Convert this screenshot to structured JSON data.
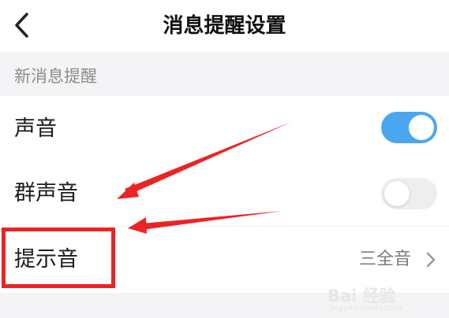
{
  "header": {
    "title": "消息提醒设置",
    "back_icon": "chevron-left-icon"
  },
  "section": {
    "label": "新消息提醒"
  },
  "rows": [
    {
      "label": "声音",
      "toggle_on": true
    },
    {
      "label": "群声音",
      "toggle_on": false
    },
    {
      "label": "提示音",
      "value": "三全音"
    }
  ],
  "colors": {
    "accent": "#4aa7ef",
    "annotation": "#ea2424"
  },
  "watermark": {
    "brand": "Bai 经验",
    "url": "jingyan.baidu.com"
  }
}
